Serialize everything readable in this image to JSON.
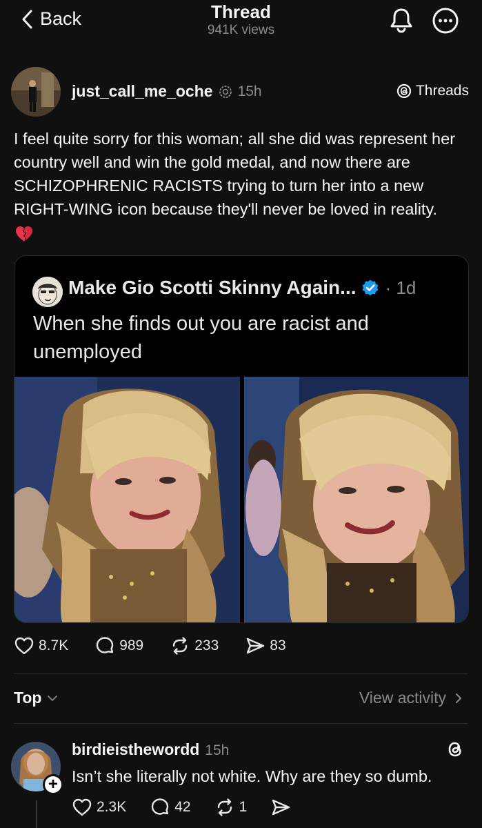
{
  "header": {
    "back_label": "Back",
    "title": "Thread",
    "views": "941K views"
  },
  "post": {
    "username": "just_call_me_oche",
    "time": "15h",
    "badge": "Threads",
    "text": "I feel quite sorry for this woman; all she did was represent her country well and win the gold medal, and now there are SCHIZOPHRENIC RACISTS trying to turn her into a new RIGHT-WING icon because they'll never be loved in reality.",
    "emoji_icon": "broken-heart-icon",
    "quote": {
      "author": "Make Gio Scotti Skinny Again...",
      "time": "· 1d",
      "verified": true,
      "text": "When she finds out you are racist and unemployed"
    },
    "stats": {
      "likes": "8.7K",
      "replies": "989",
      "reposts": "233",
      "shares": "83"
    }
  },
  "sort": {
    "label": "Top",
    "activity": "View activity"
  },
  "reply": {
    "username": "birdieisthewordd",
    "time": "15h",
    "text": "Isn’t she literally not white. Why are they so dumb.",
    "stats": {
      "likes": "2.3K",
      "replies": "42",
      "reposts": "1"
    }
  },
  "colors": {
    "background": "#101010",
    "text": "#f3f5f7",
    "muted": "#8a8a8a",
    "verified": "#1d9bf0",
    "broken_heart": "#e8334a"
  }
}
